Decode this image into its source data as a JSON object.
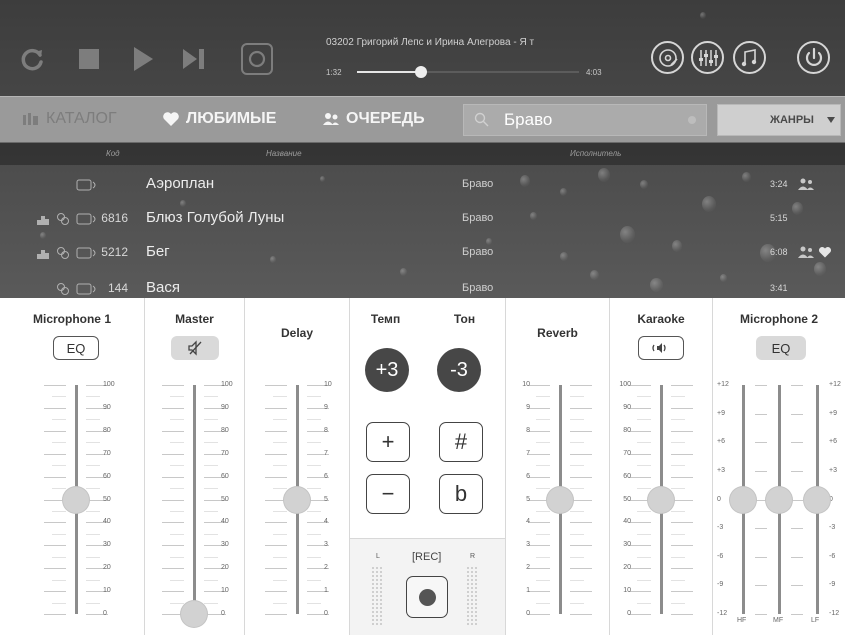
{
  "player": {
    "track_title": "03202  Григорий Лепс и Ирина Алегрова - Я т",
    "time_current": "1:32",
    "time_total": "4:03",
    "progress": 0.29
  },
  "nav": {
    "catalog": "КАТАЛОГ",
    "favorites": "ЛЮБИМЫЕ",
    "queue": "ОЧЕРЕДЬ",
    "search_value": "Браво",
    "genres": "ЖАНРЫ"
  },
  "table": {
    "headers": {
      "code": "Код",
      "title": "Название",
      "artist": "Исполнитель"
    },
    "rows": [
      {
        "code": "",
        "title": "Аэроплан",
        "artist": "Браво",
        "duration": "3:24"
      },
      {
        "code": "6816",
        "title": "Блюз Голубой Луны",
        "artist": "Браво",
        "duration": "5:15"
      },
      {
        "code": "5212",
        "title": "Бег",
        "artist": "Браво",
        "duration": "6:08"
      },
      {
        "code": "144",
        "title": "Вася",
        "artist": "Браво",
        "duration": "3:41"
      }
    ]
  },
  "mixer": {
    "mic1": {
      "title": "Microphone 1",
      "eq_label": "EQ",
      "level": 50
    },
    "master": {
      "title": "Master",
      "level": 0
    },
    "delay": {
      "title": "Delay",
      "level": 5
    },
    "tempo": {
      "title": "Темп",
      "value": "+3"
    },
    "tone": {
      "title": "Тон",
      "value": "-3"
    },
    "plus": "+",
    "minus": "−",
    "sharp": "#",
    "flat": "b",
    "rec": {
      "label": "[REC]",
      "left": "L",
      "right": "R"
    },
    "reverb": {
      "title": "Reverb",
      "level": 5
    },
    "karaoke": {
      "title": "Karaoke",
      "level": 50
    },
    "mic2": {
      "title": "Microphone 2",
      "eq_label": "EQ",
      "hf": 0,
      "mf": 0,
      "lf": 0,
      "band_labels": [
        "HF",
        "MF",
        "LF"
      ]
    },
    "scale_100": [
      "100",
      "90",
      "80",
      "70",
      "60",
      "50",
      "40",
      "30",
      "20",
      "10",
      "0"
    ],
    "scale_10": [
      "10",
      "9",
      "8",
      "7",
      "6",
      "5",
      "4",
      "3",
      "2",
      "1",
      "0"
    ],
    "scale_eq": [
      "+12",
      "+9",
      "+6",
      "+3",
      "0",
      "-3",
      "-6",
      "-9",
      "-12"
    ]
  }
}
